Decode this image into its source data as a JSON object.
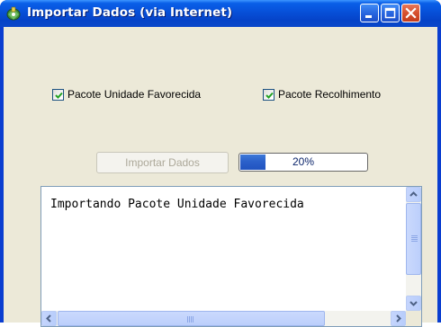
{
  "window": {
    "title": "Importar Dados (via Internet)",
    "icon": "app-import-icon",
    "controls": [
      "minimize-icon",
      "maximize-icon",
      "close-icon"
    ]
  },
  "options": {
    "pacote_unidade": {
      "label": "Pacote Unidade Favorecida",
      "checked": true
    },
    "pacote_recolhimento": {
      "label": "Pacote Recolhimento",
      "checked": true
    }
  },
  "import_button": {
    "label": "Importar Dados",
    "enabled": false
  },
  "progress": {
    "text": "20%",
    "value": 0.2
  },
  "log": {
    "text": "Importando Pacote Unidade Favorecida"
  },
  "colors": {
    "titlebar": "#0a5fe8",
    "client": "#ece9d8",
    "progress_fill": "#2a5fc9",
    "close_button": "#d6512f"
  }
}
